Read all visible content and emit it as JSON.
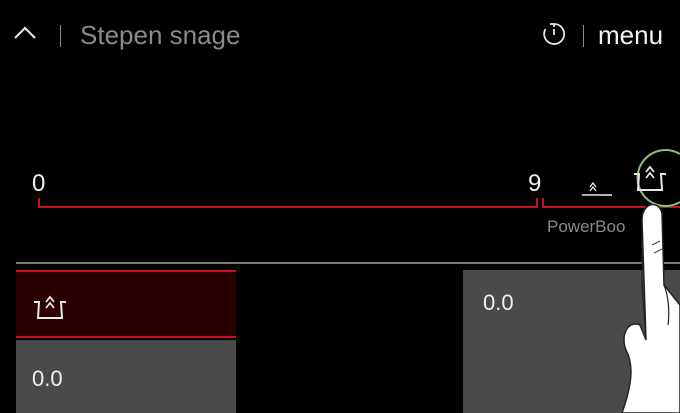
{
  "header": {
    "title": "Stepen snage",
    "menu_label": "menu",
    "icons": [
      "chevron-up-icon",
      "timer-icon"
    ]
  },
  "slider": {
    "min_label": "0",
    "max_label": "9",
    "boost_label": "PowerBoo",
    "icons": [
      "pot-heat-small-icon",
      "powerboost-icon"
    ]
  },
  "zone_left": {
    "icon": "powerboost-icon",
    "value": "0.0"
  },
  "zone_right": {
    "value": "0.0"
  },
  "colors": {
    "accent": "#c1121f",
    "background": "#000000",
    "panel_gray": "#4a4a4a",
    "panel_dark_red": "#2a0000",
    "focus_ring": "#8fbf7a"
  }
}
